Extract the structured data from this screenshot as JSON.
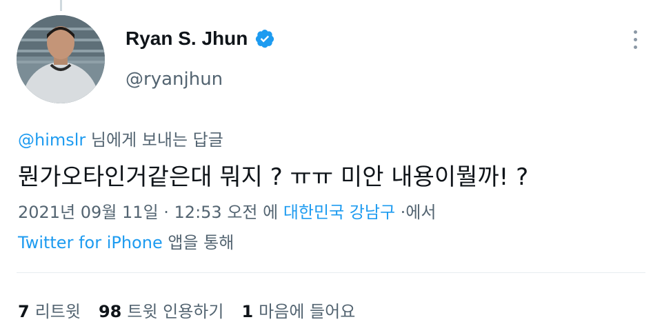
{
  "colors": {
    "text": "#0f1419",
    "secondary": "#536471",
    "link": "#1d9bf0",
    "verified": "#1d9bf0"
  },
  "author": {
    "display_name": "Ryan S. Jhun",
    "handle": "@ryanjhun",
    "verified": true
  },
  "reply": {
    "mention": "@himslr",
    "suffix": " 님에게 보내는 답글"
  },
  "tweet": {
    "text": "뭔가오타인거같은대 뭐지 ? ㅠㅠ 미안 내용이뭘까! ?"
  },
  "meta": {
    "datetime": "2021년 09월 11일 · 12:53 오전 에 ",
    "location": "대한민국 강남구",
    "location_suffix": " ·에서",
    "source": "Twitter for iPhone",
    "source_suffix": " 앱을 통해"
  },
  "stats": [
    {
      "count": "7",
      "label": "리트윗"
    },
    {
      "count": "98",
      "label": "트윗 인용하기"
    },
    {
      "count": "1",
      "label": "마음에 들어요"
    }
  ],
  "icons": {
    "verified": "verified-badge-icon",
    "more": "more-vertical-icon"
  }
}
